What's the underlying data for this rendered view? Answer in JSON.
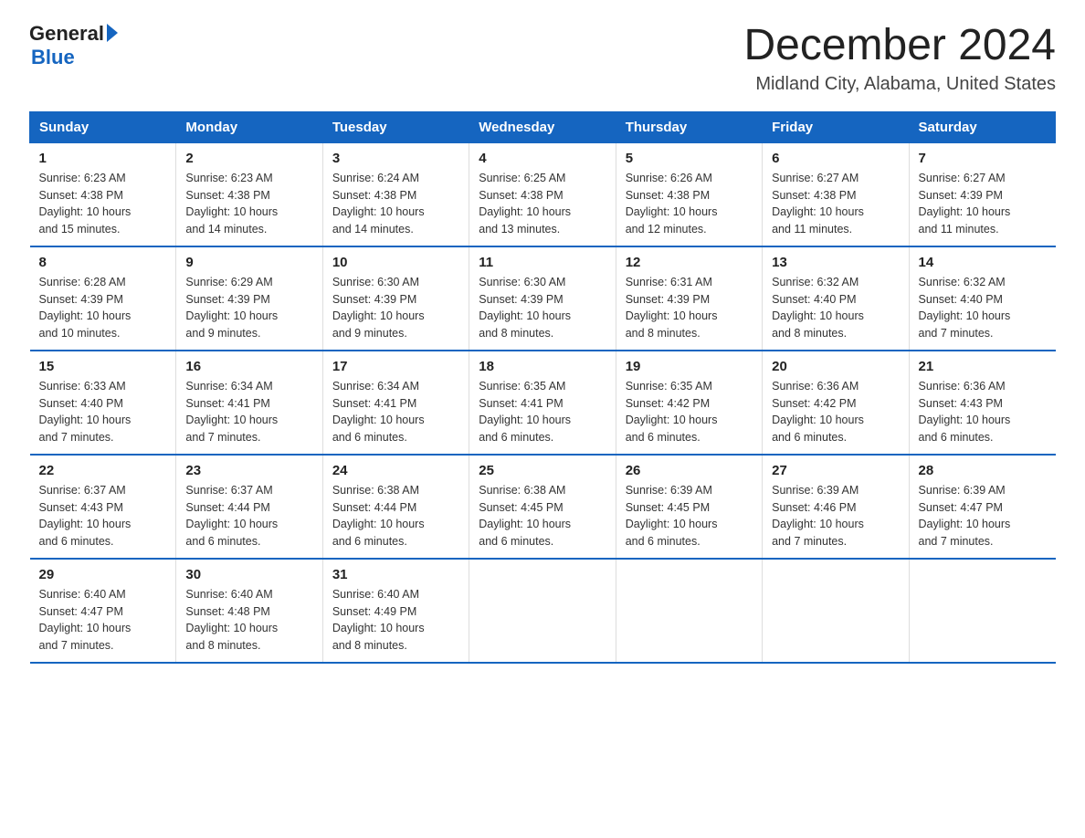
{
  "logo": {
    "general": "General",
    "blue": "Blue"
  },
  "title": "December 2024",
  "subtitle": "Midland City, Alabama, United States",
  "days_of_week": [
    "Sunday",
    "Monday",
    "Tuesday",
    "Wednesday",
    "Thursday",
    "Friday",
    "Saturday"
  ],
  "weeks": [
    [
      {
        "day": "1",
        "sunrise": "6:23 AM",
        "sunset": "4:38 PM",
        "daylight": "10 hours and 15 minutes."
      },
      {
        "day": "2",
        "sunrise": "6:23 AM",
        "sunset": "4:38 PM",
        "daylight": "10 hours and 14 minutes."
      },
      {
        "day": "3",
        "sunrise": "6:24 AM",
        "sunset": "4:38 PM",
        "daylight": "10 hours and 14 minutes."
      },
      {
        "day": "4",
        "sunrise": "6:25 AM",
        "sunset": "4:38 PM",
        "daylight": "10 hours and 13 minutes."
      },
      {
        "day": "5",
        "sunrise": "6:26 AM",
        "sunset": "4:38 PM",
        "daylight": "10 hours and 12 minutes."
      },
      {
        "day": "6",
        "sunrise": "6:27 AM",
        "sunset": "4:38 PM",
        "daylight": "10 hours and 11 minutes."
      },
      {
        "day": "7",
        "sunrise": "6:27 AM",
        "sunset": "4:39 PM",
        "daylight": "10 hours and 11 minutes."
      }
    ],
    [
      {
        "day": "8",
        "sunrise": "6:28 AM",
        "sunset": "4:39 PM",
        "daylight": "10 hours and 10 minutes."
      },
      {
        "day": "9",
        "sunrise": "6:29 AM",
        "sunset": "4:39 PM",
        "daylight": "10 hours and 9 minutes."
      },
      {
        "day": "10",
        "sunrise": "6:30 AM",
        "sunset": "4:39 PM",
        "daylight": "10 hours and 9 minutes."
      },
      {
        "day": "11",
        "sunrise": "6:30 AM",
        "sunset": "4:39 PM",
        "daylight": "10 hours and 8 minutes."
      },
      {
        "day": "12",
        "sunrise": "6:31 AM",
        "sunset": "4:39 PM",
        "daylight": "10 hours and 8 minutes."
      },
      {
        "day": "13",
        "sunrise": "6:32 AM",
        "sunset": "4:40 PM",
        "daylight": "10 hours and 8 minutes."
      },
      {
        "day": "14",
        "sunrise": "6:32 AM",
        "sunset": "4:40 PM",
        "daylight": "10 hours and 7 minutes."
      }
    ],
    [
      {
        "day": "15",
        "sunrise": "6:33 AM",
        "sunset": "4:40 PM",
        "daylight": "10 hours and 7 minutes."
      },
      {
        "day": "16",
        "sunrise": "6:34 AM",
        "sunset": "4:41 PM",
        "daylight": "10 hours and 7 minutes."
      },
      {
        "day": "17",
        "sunrise": "6:34 AM",
        "sunset": "4:41 PM",
        "daylight": "10 hours and 6 minutes."
      },
      {
        "day": "18",
        "sunrise": "6:35 AM",
        "sunset": "4:41 PM",
        "daylight": "10 hours and 6 minutes."
      },
      {
        "day": "19",
        "sunrise": "6:35 AM",
        "sunset": "4:42 PM",
        "daylight": "10 hours and 6 minutes."
      },
      {
        "day": "20",
        "sunrise": "6:36 AM",
        "sunset": "4:42 PM",
        "daylight": "10 hours and 6 minutes."
      },
      {
        "day": "21",
        "sunrise": "6:36 AM",
        "sunset": "4:43 PM",
        "daylight": "10 hours and 6 minutes."
      }
    ],
    [
      {
        "day": "22",
        "sunrise": "6:37 AM",
        "sunset": "4:43 PM",
        "daylight": "10 hours and 6 minutes."
      },
      {
        "day": "23",
        "sunrise": "6:37 AM",
        "sunset": "4:44 PM",
        "daylight": "10 hours and 6 minutes."
      },
      {
        "day": "24",
        "sunrise": "6:38 AM",
        "sunset": "4:44 PM",
        "daylight": "10 hours and 6 minutes."
      },
      {
        "day": "25",
        "sunrise": "6:38 AM",
        "sunset": "4:45 PM",
        "daylight": "10 hours and 6 minutes."
      },
      {
        "day": "26",
        "sunrise": "6:39 AM",
        "sunset": "4:45 PM",
        "daylight": "10 hours and 6 minutes."
      },
      {
        "day": "27",
        "sunrise": "6:39 AM",
        "sunset": "4:46 PM",
        "daylight": "10 hours and 7 minutes."
      },
      {
        "day": "28",
        "sunrise": "6:39 AM",
        "sunset": "4:47 PM",
        "daylight": "10 hours and 7 minutes."
      }
    ],
    [
      {
        "day": "29",
        "sunrise": "6:40 AM",
        "sunset": "4:47 PM",
        "daylight": "10 hours and 7 minutes."
      },
      {
        "day": "30",
        "sunrise": "6:40 AM",
        "sunset": "4:48 PM",
        "daylight": "10 hours and 8 minutes."
      },
      {
        "day": "31",
        "sunrise": "6:40 AM",
        "sunset": "4:49 PM",
        "daylight": "10 hours and 8 minutes."
      },
      null,
      null,
      null,
      null
    ]
  ],
  "labels": {
    "sunrise": "Sunrise:",
    "sunset": "Sunset:",
    "daylight": "Daylight:"
  }
}
